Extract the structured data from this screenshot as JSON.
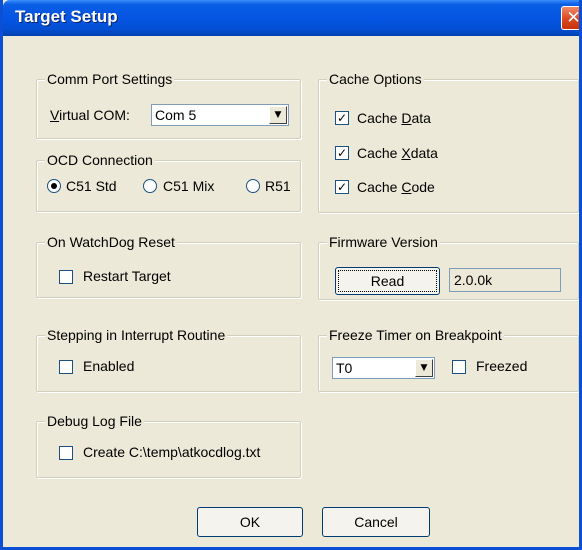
{
  "window": {
    "title": "Target Setup"
  },
  "comm_port": {
    "label": "Comm Port Settings",
    "virtual_com_prefix": "V",
    "virtual_com_rest": "irtual COM:",
    "value": "Com 5"
  },
  "ocd": {
    "label": "OCD Connection",
    "options": [
      {
        "label": "C51 Std",
        "selected": true
      },
      {
        "label": "C51 Mix",
        "selected": false
      },
      {
        "label": "R51",
        "selected": false
      }
    ]
  },
  "cache": {
    "label": "Cache Options",
    "items": [
      {
        "pre": "Cache ",
        "key": "D",
        "post": "ata",
        "checked": true
      },
      {
        "pre": "Cache ",
        "key": "X",
        "post": "data",
        "checked": true
      },
      {
        "pre": "Cache ",
        "key": "C",
        "post": "ode",
        "checked": true
      }
    ]
  },
  "watchdog": {
    "label": "On WatchDog Reset",
    "option": "Restart Target",
    "checked": false
  },
  "firmware": {
    "label": "Firmware Version",
    "read_button": "Read",
    "version": "2.0.0k"
  },
  "stepping": {
    "label": "Stepping in Interrupt Routine",
    "option": "Enabled",
    "checked": false
  },
  "freeze": {
    "label": "Freeze Timer on Breakpoint",
    "timer": "T0",
    "option": "Freezed",
    "checked": false
  },
  "debug_log": {
    "label": "Debug Log File",
    "option": "Create C:\\temp\\atkocdlog.txt",
    "checked": false
  },
  "buttons": {
    "ok": "OK",
    "cancel": "Cancel"
  }
}
